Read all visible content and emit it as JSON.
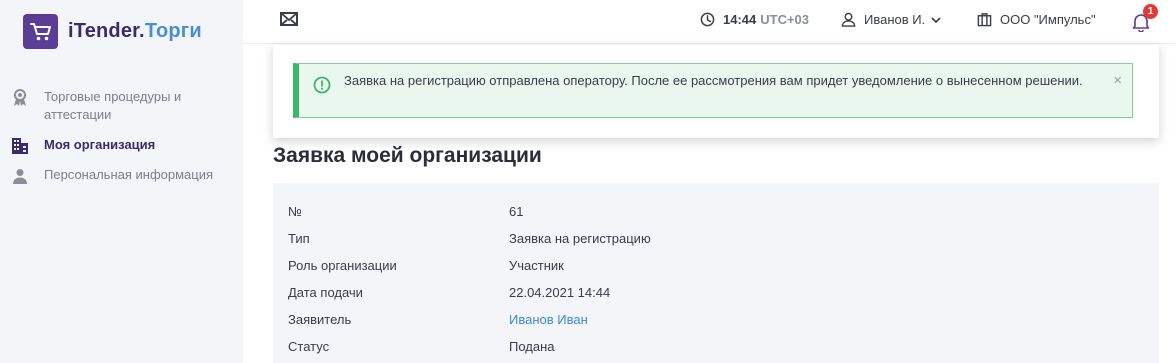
{
  "app": {
    "logo_prefix": "iTender.",
    "logo_suffix": "Торги"
  },
  "sidebar": {
    "items": [
      {
        "label": "Торговые процедуры и аттестации",
        "icon": "award-icon",
        "active": false
      },
      {
        "label": "Моя организация",
        "icon": "building-icon",
        "active": true
      },
      {
        "label": "Персональная информация",
        "icon": "person-icon",
        "active": false
      }
    ]
  },
  "header": {
    "time": "14:44",
    "timezone": "UTC+03",
    "user": "Иванов И.",
    "organization": "ООО \"Импульс\"",
    "notifications_count": "1"
  },
  "alert": {
    "text": "Заявка на регистрацию отправлена оператору. После ее рассмотрения вам придет уведомление о вынесенном решении.",
    "close": "×"
  },
  "page": {
    "title": "Заявка моей организации"
  },
  "details": [
    {
      "label": "№",
      "value": "61"
    },
    {
      "label": "Тип",
      "value": "Заявка на регистрацию"
    },
    {
      "label": "Роль организации",
      "value": "Участник"
    },
    {
      "label": "Дата подачи",
      "value": "22.04.2021 14:44"
    },
    {
      "label": "Заявитель",
      "value": "Иванов Иван"
    },
    {
      "label": "Статус",
      "value": "Подана"
    }
  ],
  "colors": {
    "brand": "#5b3d96",
    "accent": "#4a8fd6",
    "success": "#39b86a",
    "link": "#3b8ad9",
    "badge": "#e53935"
  }
}
